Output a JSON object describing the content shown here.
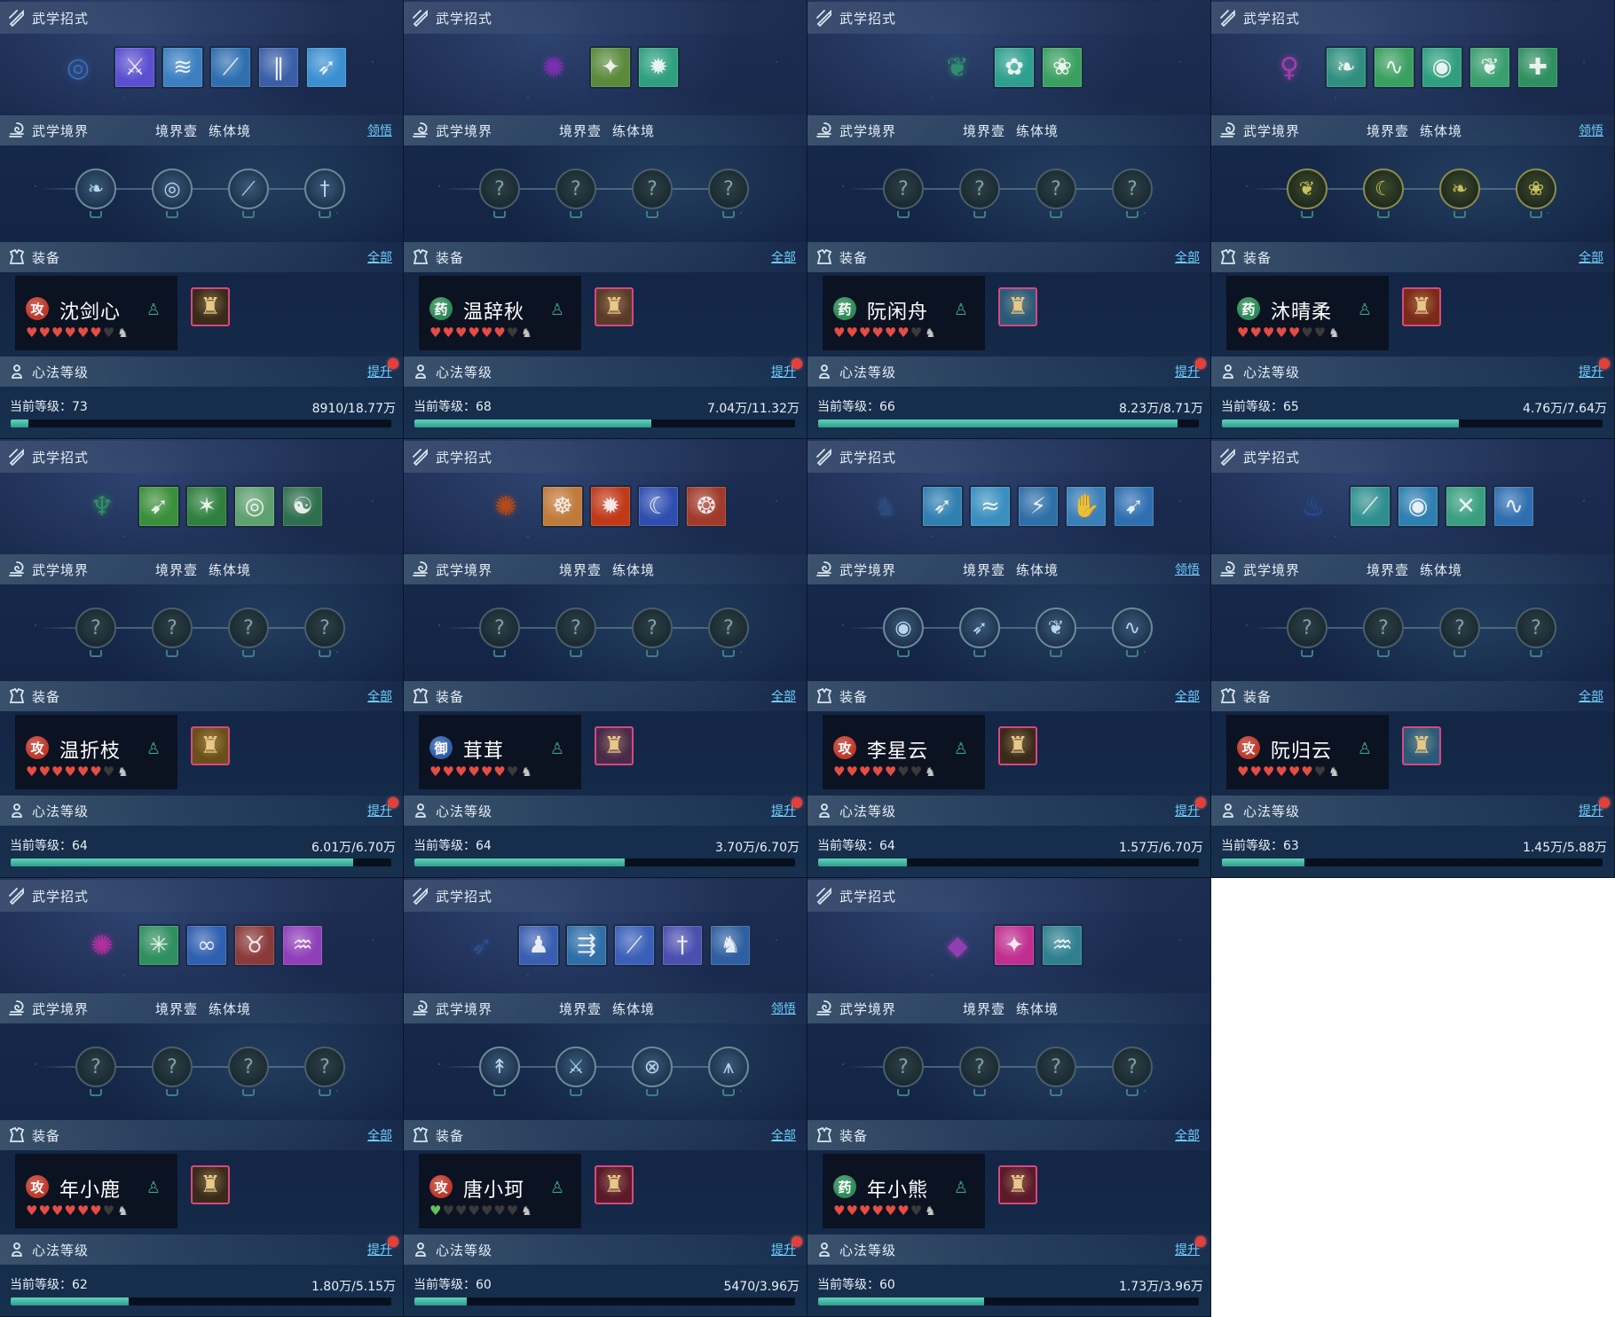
{
  "labels": {
    "skills_title": "武学招式",
    "realm_title": "武学境界",
    "realm_level": "境界壹",
    "realm_stage": "练体境",
    "comprehend": "领悟",
    "equip_title": "装备",
    "equip_all": "全部",
    "xinfa_title": "心法等级",
    "upgrade": "提升",
    "current_level_prefix": "当前等级："
  },
  "colors": {
    "accent_link": "#6ed0ff",
    "progress_fill": "#3fb8a0",
    "gear_border": "#d6487f",
    "red_dot": "#e3403b",
    "heart_full": "#e74c43"
  },
  "characters": [
    {
      "name": "沈剑心",
      "role": "攻",
      "role_type": "attack",
      "hearts_full": 6,
      "hearts_total": 7,
      "heart_color": "red",
      "level": 73,
      "exp_text": "8910/18.77万",
      "progress": 0.047,
      "show_comprehend": true,
      "skill_icons": [
        "sword-swirl-icon",
        "sword-slash-icon",
        "water-vortex-icon",
        "blade-wave-icon",
        "sword-rain-icon",
        "dash-strike-icon"
      ],
      "skill_colors": [
        "#3a6fb8",
        "#5a4fd0",
        "#3a7fc0",
        "#2f6fb0",
        "#3a5fa8",
        "#3a8fd0"
      ],
      "node_style": "on",
      "node_icons": [
        "feather-icon",
        "spiral-icon",
        "blade-icon",
        "sword-icon"
      ],
      "gear_icon": "armor-icon",
      "gear_bg": "#3a2a1a"
    },
    {
      "name": "温辞秋",
      "role": "药",
      "role_type": "heal",
      "hearts_full": 6,
      "hearts_total": 7,
      "heart_color": "red",
      "level": 68,
      "exp_text": "7.04万/11.32万",
      "progress": 0.622,
      "show_comprehend": false,
      "skill_icons": [
        "purple-flame-icon",
        "green-fan-icon",
        "radiant-sun-icon"
      ],
      "skill_colors": [
        "#7a2fb0",
        "#5a8a3a",
        "#2fa07f"
      ],
      "node_style": "locked",
      "node_icons": [
        "locked-icon",
        "locked-icon",
        "locked-icon",
        "locked-icon"
      ],
      "gear_icon": "robe-icon",
      "gear_bg": "#5a3a28"
    },
    {
      "name": "阮闲舟",
      "role": "药",
      "role_type": "heal",
      "hearts_full": 6,
      "hearts_total": 7,
      "heart_color": "red",
      "level": 66,
      "exp_text": "8.23万/8.71万",
      "progress": 0.945,
      "show_comprehend": false,
      "skill_icons": [
        "leaf-spirit-icon",
        "flower-bloom-icon",
        "lotus-icon"
      ],
      "skill_colors": [
        "#2f8f6f",
        "#2f9f8f",
        "#3aa060"
      ],
      "node_style": "locked",
      "node_icons": [
        "locked-icon",
        "locked-icon",
        "locked-icon",
        "locked-icon"
      ],
      "gear_icon": "cloak-icon",
      "gear_bg": "#2a5a7a"
    },
    {
      "name": "沐晴柔",
      "role": "药",
      "role_type": "heal",
      "hearts_full": 5,
      "hearts_total": 7,
      "heart_color": "red",
      "level": 65,
      "exp_text": "4.76万/7.64万",
      "progress": 0.623,
      "show_comprehend": true,
      "skill_icons": [
        "dancer-icon",
        "wind-leaf-icon",
        "green-wave-icon",
        "vortex-icon",
        "leaf-swirl-icon",
        "healer-icon"
      ],
      "skill_colors": [
        "#a03fb0",
        "#2f8f7f",
        "#3aa060",
        "#2f9f7f",
        "#3a9f6f",
        "#2f8f5f"
      ],
      "node_style": "gold",
      "node_icons": [
        "wing-icon",
        "moon-icon",
        "leaf-icon",
        "lotus-icon"
      ],
      "gear_icon": "flame-armor-icon",
      "gear_bg": "#7a2a18"
    },
    {
      "name": "温折枝",
      "role": "攻",
      "role_type": "attack",
      "hearts_full": 6,
      "hearts_total": 7,
      "heart_color": "red",
      "level": 64,
      "exp_text": "6.01万/6.70万",
      "progress": 0.9,
      "show_comprehend": false,
      "skill_icons": [
        "green-aura-icon",
        "leaf-dart-icon",
        "thorn-icon",
        "ring-icon",
        "taiji-icon"
      ],
      "skill_colors": [
        "#2f8f5f",
        "#3a8f3a",
        "#2f7f3f",
        "#5fa070",
        "#2f6f4f"
      ],
      "node_style": "locked",
      "node_icons": [
        "locked-icon",
        "locked-icon",
        "locked-icon",
        "locked-icon"
      ],
      "gear_icon": "gold-armor-icon",
      "gear_bg": "#6a5018"
    },
    {
      "name": "茸茸",
      "role": "御",
      "role_type": "defense",
      "hearts_full": 6,
      "hearts_total": 7,
      "heart_color": "red",
      "level": 64,
      "exp_text": "3.70万/6.70万",
      "progress": 0.552,
      "show_comprehend": false,
      "skill_icons": [
        "fire-monk-icon",
        "buddha-icon",
        "explosion-icon",
        "crescent-icon",
        "fire-swirl-icon"
      ],
      "skill_colors": [
        "#b04a1a",
        "#c07a3a",
        "#c03a1a",
        "#2f4fb0",
        "#a03a2a"
      ],
      "node_style": "locked",
      "node_icons": [
        "locked-icon",
        "locked-icon",
        "locked-icon",
        "locked-icon"
      ],
      "gear_icon": "spiked-armor-icon",
      "gear_bg": "#4a2a4a"
    },
    {
      "name": "李星云",
      "role": "攻",
      "role_type": "attack",
      "hearts_full": 5,
      "hearts_total": 7,
      "heart_color": "red",
      "level": 64,
      "exp_text": "1.57万/6.70万",
      "progress": 0.234,
      "show_comprehend": true,
      "skill_icons": [
        "martial-stance-icon",
        "kick-icon",
        "wind-slash-icon",
        "claw-icon",
        "palm-strike-icon",
        "leap-icon"
      ],
      "skill_colors": [
        "#2a4a7a",
        "#2f7fb0",
        "#3a8fc0",
        "#2f6fa8",
        "#3a7fb8",
        "#2f6fb0"
      ],
      "node_style": "on",
      "node_icons": [
        "swirl-icon",
        "bird-icon",
        "wing-icon",
        "wave-icon"
      ],
      "gear_icon": "dark-armor-icon",
      "gear_bg": "#3a2a1a"
    },
    {
      "name": "阮归云",
      "role": "攻",
      "role_type": "attack",
      "hearts_full": 6,
      "hearts_total": 7,
      "heart_color": "red",
      "level": 63,
      "exp_text": "1.45万/5.88万",
      "progress": 0.216,
      "show_comprehend": false,
      "skill_icons": [
        "blue-flame-icon",
        "jade-slash-icon",
        "tornado-icon",
        "cross-slash-icon",
        "tide-icon"
      ],
      "skill_colors": [
        "#2a4f9f",
        "#2f8f8f",
        "#2f7fb0",
        "#3a9f7f",
        "#2f6fb0"
      ],
      "node_style": "locked",
      "node_icons": [
        "locked-icon",
        "locked-icon",
        "locked-icon",
        "locked-icon"
      ],
      "gear_icon": "cloak-icon",
      "gear_bg": "#2a5a7a"
    },
    {
      "name": "年小鹿",
      "role": "攻",
      "role_type": "attack",
      "hearts_full": 6,
      "hearts_total": 7,
      "heart_color": "red",
      "level": 62,
      "exp_text": "1.80万/5.15万",
      "progress": 0.31,
      "show_comprehend": false,
      "skill_icons": [
        "magenta-orb-icon",
        "green-burst-icon",
        "blue-coil-icon",
        "red-beast-icon",
        "purple-tornado-icon"
      ],
      "skill_colors": [
        "#b02fa0",
        "#2f8f5f",
        "#2f5fb0",
        "#8a3a3a",
        "#8f3fb8"
      ],
      "node_style": "locked",
      "node_icons": [
        "locked-icon",
        "locked-icon",
        "locked-icon",
        "locked-icon"
      ],
      "gear_icon": "dark-armor-icon",
      "gear_bg": "#3a2a1a"
    },
    {
      "name": "唐小珂",
      "role": "攻",
      "role_type": "attack",
      "hearts_full": 1,
      "hearts_total": 7,
      "heart_color": "green",
      "level": 60,
      "exp_text": "5470/3.96万",
      "progress": 0.138,
      "show_comprehend": true,
      "skill_icons": [
        "bird-strike-icon",
        "ninja-icon",
        "arrow-rain-icon",
        "spear-icon",
        "dagger-icon",
        "shadow-icon"
      ],
      "skill_colors": [
        "#2f4f8f",
        "#3a5fb0",
        "#2f6fa8",
        "#3a5fb8",
        "#4a4fb0",
        "#2f5fa0"
      ],
      "node_style": "on",
      "node_icons": [
        "arrow-icon",
        "crossbow-icon",
        "target-icon",
        "trap-icon"
      ],
      "gear_icon": "red-armor-icon",
      "gear_bg": "#5a1a2a"
    },
    {
      "name": "年小熊",
      "role": "药",
      "role_type": "heal",
      "hearts_full": 6,
      "hearts_total": 7,
      "heart_color": "red",
      "level": 60,
      "exp_text": "1.73万/3.96万",
      "progress": 0.437,
      "show_comprehend": false,
      "skill_icons": [
        "crystal-icon",
        "pink-blade-icon",
        "shark-icon"
      ],
      "skill_colors": [
        "#8f3fb0",
        "#c02f8f",
        "#2f7f8f"
      ],
      "node_style": "locked",
      "node_icons": [
        "locked-icon",
        "locked-icon",
        "locked-icon",
        "locked-icon"
      ],
      "gear_icon": "red-armor-icon",
      "gear_bg": "#5a1a2a"
    }
  ]
}
